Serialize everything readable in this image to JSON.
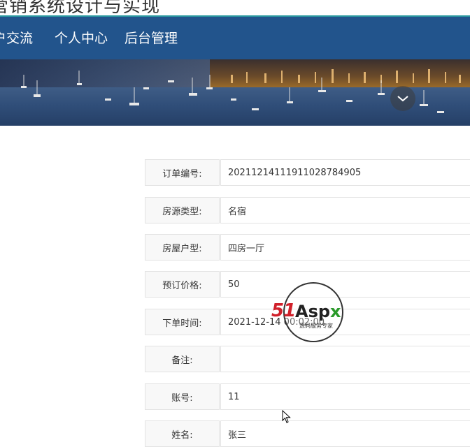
{
  "header": {
    "site_title": "营销系统设计与实现"
  },
  "nav": {
    "items": [
      {
        "label": "户交流"
      },
      {
        "label": "个人中心"
      },
      {
        "label": "后台管理"
      }
    ]
  },
  "banner": {
    "toggle_icon": "chevron-down-icon"
  },
  "order_detail": {
    "rows": [
      {
        "label": "订单编号:",
        "value": "20211214111911028784905"
      },
      {
        "label": "房源类型:",
        "value": "名宿"
      },
      {
        "label": "房屋户型:",
        "value": "四房一厅"
      },
      {
        "label": "预订价格:",
        "value": "50"
      },
      {
        "label": "下单时间:",
        "value": "2021-12-14 00:02:00"
      },
      {
        "label": "备注:",
        "value": ""
      },
      {
        "label": "账号:",
        "value": "11"
      },
      {
        "label": "姓名:",
        "value": "张三"
      }
    ]
  },
  "watermark": {
    "brand_51": "51",
    "brand_asp": "Asp",
    "brand_x": "x",
    "tagline": "源码服务专家"
  },
  "colors": {
    "nav_bg": "#22548c",
    "nav_border": "#2a9aa0",
    "label_bg": "#f8f8f8",
    "border": "#e2e2e2"
  }
}
